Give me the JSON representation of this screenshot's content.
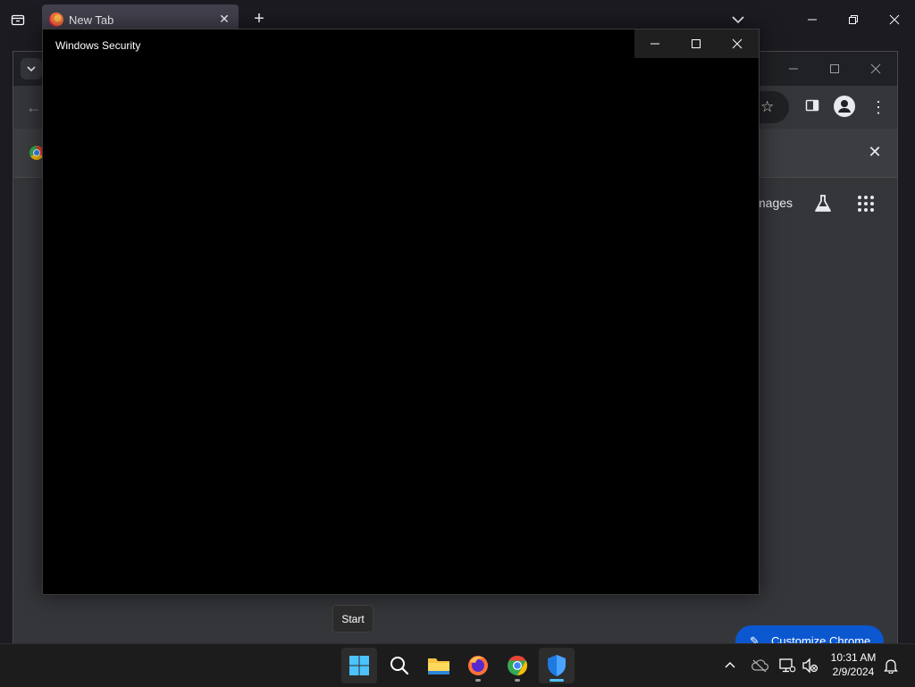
{
  "firefox": {
    "tab_title": "New Tab"
  },
  "chrome": {
    "search_chip_partial": "mages",
    "customize_label": "Customize Chrome"
  },
  "security_window": {
    "title": "Windows Security"
  },
  "tooltip": {
    "text": "Start"
  },
  "taskbar": {
    "apps": [
      {
        "name": "start",
        "icon": "windows-logo-icon"
      },
      {
        "name": "search",
        "icon": "search-icon"
      },
      {
        "name": "file-explorer",
        "icon": "folder-icon"
      },
      {
        "name": "firefox",
        "icon": "firefox-icon"
      },
      {
        "name": "chrome",
        "icon": "chrome-icon"
      },
      {
        "name": "windows-security",
        "icon": "shield-icon"
      }
    ],
    "time": "10:31 AM",
    "date": "2/9/2024"
  },
  "colors": {
    "taskbar_bg": "#1c1c1c",
    "accent": "#4cc2ff",
    "chrome_button": "#0b57d0",
    "security_bg": "#000000"
  }
}
